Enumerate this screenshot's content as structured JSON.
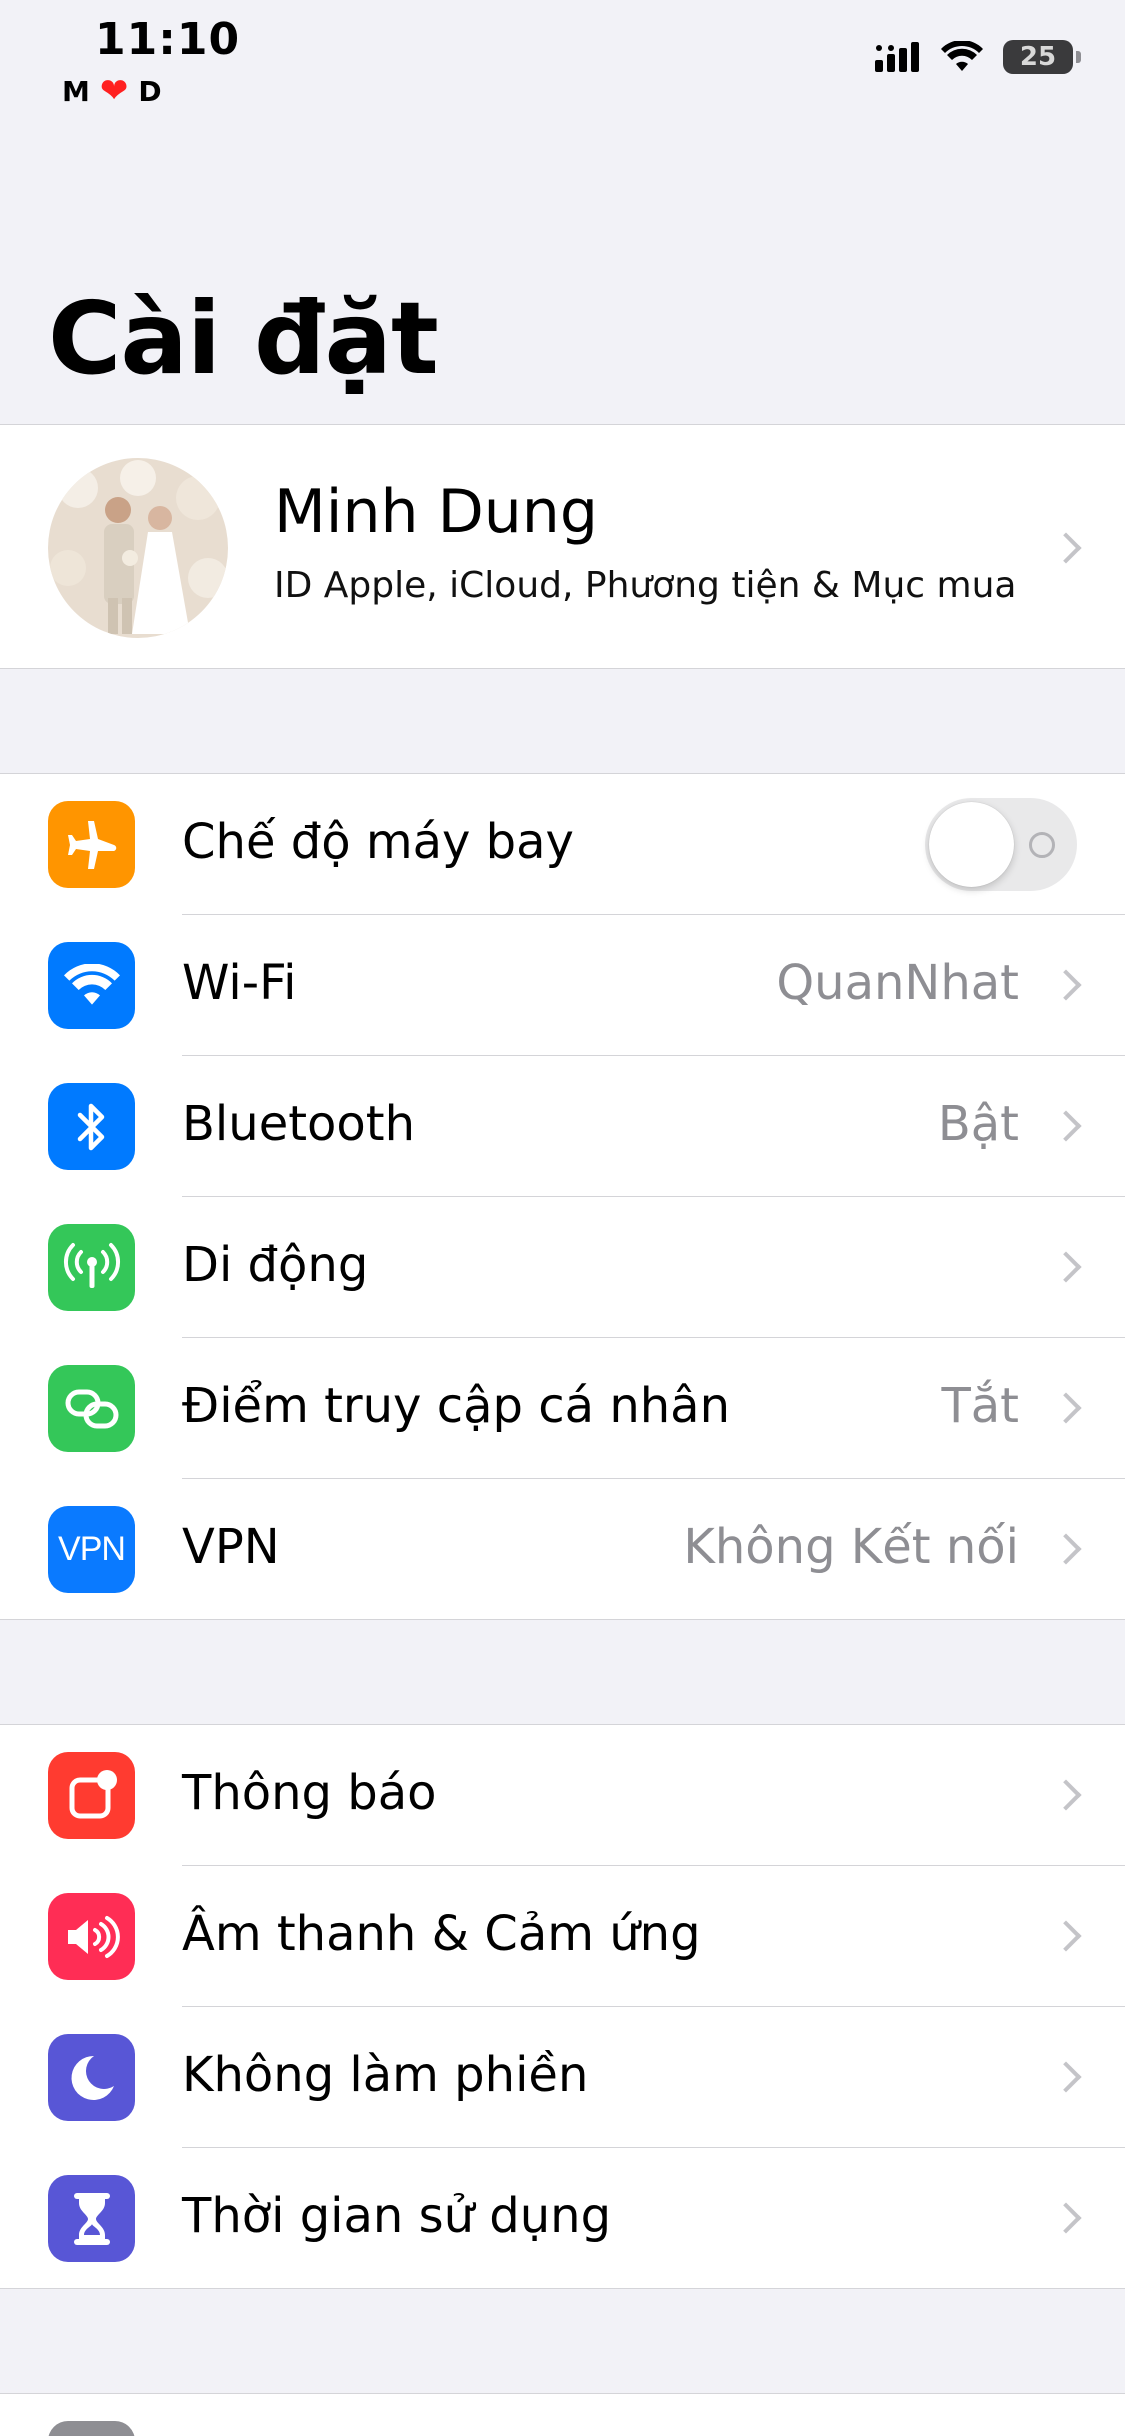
{
  "status_bar": {
    "time": "11:10",
    "carrier_left": "M",
    "carrier_right": "D",
    "battery": "25"
  },
  "title": "Cài đặt",
  "profile": {
    "name": "Minh Dung",
    "subtitle": "ID Apple, iCloud, Phương tiện & Mục mua"
  },
  "network_group": [
    {
      "label": "Chế độ máy bay",
      "value": "",
      "icon": "airplane-icon",
      "color": "#ff9500",
      "toggle": false
    },
    {
      "label": "Wi-Fi",
      "value": "QuanNhat",
      "icon": "wifi-icon",
      "color": "#007aff"
    },
    {
      "label": "Bluetooth",
      "value": "Bật",
      "icon": "bluetooth-icon",
      "color": "#007aff"
    },
    {
      "label": "Di động",
      "value": "",
      "icon": "antenna-icon",
      "color": "#34c759"
    },
    {
      "label": "Điểm truy cập cá nhân",
      "value": "Tắt",
      "icon": "hotspot-icon",
      "color": "#34c759"
    },
    {
      "label": "VPN",
      "value": "Không Kết nối",
      "icon": "vpn-icon",
      "icon_text": "VPN",
      "color": "#0a7aff"
    }
  ],
  "notification_group": [
    {
      "label": "Thông báo",
      "icon": "notification-icon",
      "color": "#ff3b30"
    },
    {
      "label": "Âm thanh & Cảm ứng",
      "icon": "speaker-icon",
      "color": "#ff2d55"
    },
    {
      "label": "Không làm phiền",
      "icon": "moon-icon",
      "color": "#5856d6"
    },
    {
      "label": "Thời gian sử dụng",
      "icon": "hourglass-icon",
      "color": "#5856d6"
    }
  ]
}
